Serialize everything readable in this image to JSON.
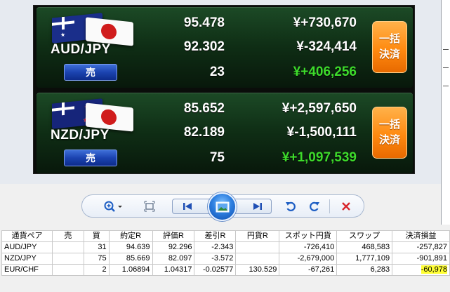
{
  "positions": [
    {
      "pair": "AUD/JPY",
      "side": "売",
      "rates": [
        "95.478",
        "92.302",
        "23"
      ],
      "pl": [
        "¥+730,670",
        "¥-324,414",
        "¥+406,256"
      ],
      "settle_line1": "一括",
      "settle_line2": "決済"
    },
    {
      "pair": "NZD/JPY",
      "side": "売",
      "rates": [
        "85.652",
        "82.189",
        "75"
      ],
      "pl": [
        "¥+2,597,650",
        "¥-1,500,111",
        "¥+1,097,539"
      ],
      "settle_line1": "一括",
      "settle_line2": "決済"
    }
  ],
  "toolbar": {
    "icons": [
      "zoom-icon",
      "fit-window-icon",
      "previous-icon",
      "slideshow-icon",
      "next-icon",
      "rotate-left-icon",
      "rotate-right-icon",
      "delete-icon"
    ]
  },
  "table": {
    "headers": [
      "通貨ペア",
      "売",
      "買",
      "約定R",
      "評価R",
      "差引R",
      "円貨R",
      "スポット円貨",
      "スワップ",
      "決済損益"
    ],
    "rows": [
      [
        "AUD/JPY",
        "",
        "31",
        "94.639",
        "92.296",
        "-2.343",
        "",
        "-726,410",
        "468,583",
        "-257,827"
      ],
      [
        "NZD/JPY",
        "",
        "75",
        "85.669",
        "82.097",
        "-3.572",
        "",
        "-2,679,000",
        "1,777,109",
        "-901,891"
      ],
      [
        "EUR/CHF",
        "",
        "2",
        "1.06894",
        "1.04317",
        "-0.02577",
        "130.529",
        "-67,261",
        "6,283",
        "-60,978"
      ]
    ]
  },
  "colors": {
    "panel_bg": "#0a0d0a",
    "profit_green": "#3ddb2b",
    "settle_orange": "#ff8a10",
    "sell_blue": "#1b43b0",
    "highlight": "#ffff33"
  }
}
